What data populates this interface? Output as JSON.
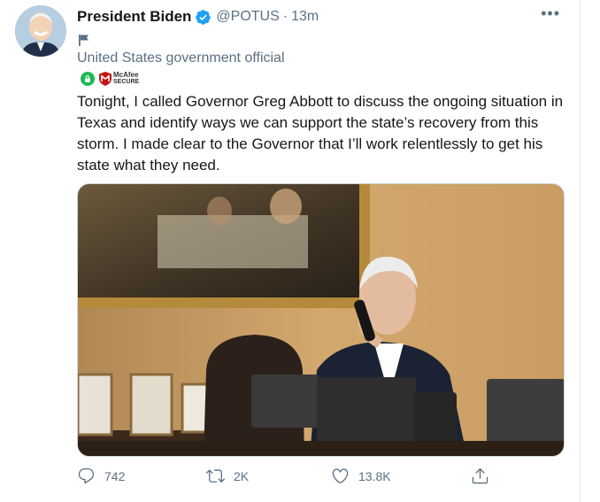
{
  "tweet": {
    "author_name": "President Biden",
    "handle": "@POTUS",
    "separator": "·",
    "time": "13m",
    "more_label": "•••",
    "government_label": "United States government official",
    "security_badge": {
      "brand": "McAfee",
      "label": "SECURE"
    },
    "text": "Tonight, I called Governor Greg Abbott to discuss the ongoing situation in Texas and identify ways we can support the state’s recovery from this storm. I made clear to the Governor that I’ll work relentlessly to get his state what they need."
  },
  "actions": {
    "replies": "742",
    "retweets": "2K",
    "likes": "13.8K"
  },
  "colors": {
    "verified": "#1da1f2",
    "secondary_text": "#5b7083",
    "primary_text": "#14171a",
    "lock_green": "#1db954",
    "mcafee_red": "#c01818"
  },
  "icons": {
    "verified": "verified-badge-icon",
    "flag": "flag-icon",
    "lock": "lock-icon",
    "mcafee": "mcafee-shield-icon",
    "reply": "reply-icon",
    "retweet": "retweet-icon",
    "like": "heart-icon",
    "share": "share-icon"
  }
}
